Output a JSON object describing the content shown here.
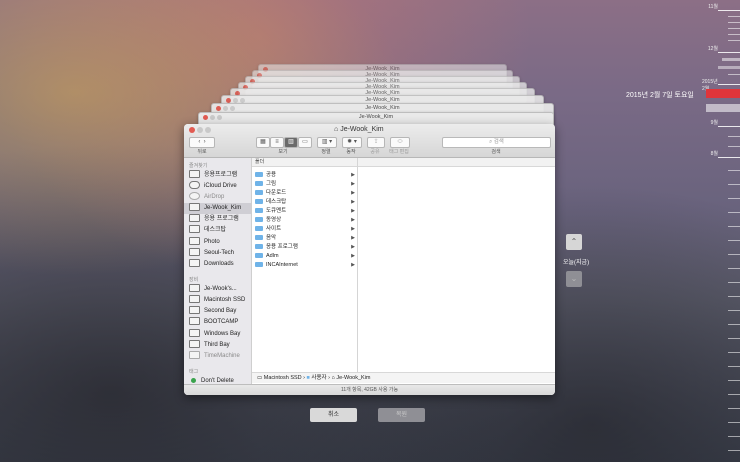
{
  "timeline": {
    "labels": [
      "11월",
      "12월",
      "2015년 2월",
      "9월",
      "8월"
    ],
    "current_date": "2015년 2월 7일 토요일",
    "highlight_color": "#e0353a"
  },
  "stack_title": "Je-Wook_Kim",
  "finder": {
    "title": "Je-Wook_Kim",
    "toolbar": {
      "back_label": "뒤로",
      "view_label": "보기",
      "arrange_label": "정렬",
      "action_label": "동작",
      "share_label": "공유",
      "tag_label": "태그 편집",
      "search_placeholder": "검색",
      "search_label": "검색"
    },
    "sidebar": {
      "favorites_head": "즐겨찾기",
      "favorites": [
        "응용프로그램",
        "iCloud Drive",
        "AirDrop",
        "Je-Wook_Kim",
        "응용 프로그램",
        "데스크탑",
        "Photo",
        "Seoul-Tech",
        "Downloads"
      ],
      "devices_head": "장비",
      "devices": [
        "Je-Wook's...",
        "Macintosh SSD",
        "Second Bay",
        "BOOTCAMP",
        "Windows Bay",
        "Third Bay",
        "TimeMachine"
      ],
      "tags_head": "태그",
      "tags": [
        "Don't Delete"
      ]
    },
    "column_head": "폴더",
    "items": [
      "공용",
      "그림",
      "다운로드",
      "데스크탑",
      "도큐멘트",
      "동영상",
      "사이트",
      "음악",
      "응용 프로그램",
      "Adlm",
      "INCAInternet"
    ],
    "path": [
      "Macintosh SSD",
      "사용자",
      "Je-Wook_Kim"
    ],
    "status": "11개 항목, 42GB 사용 가능"
  },
  "buttons": {
    "cancel": "취소",
    "restore": "복원"
  },
  "today_label": "오늘(지금)"
}
